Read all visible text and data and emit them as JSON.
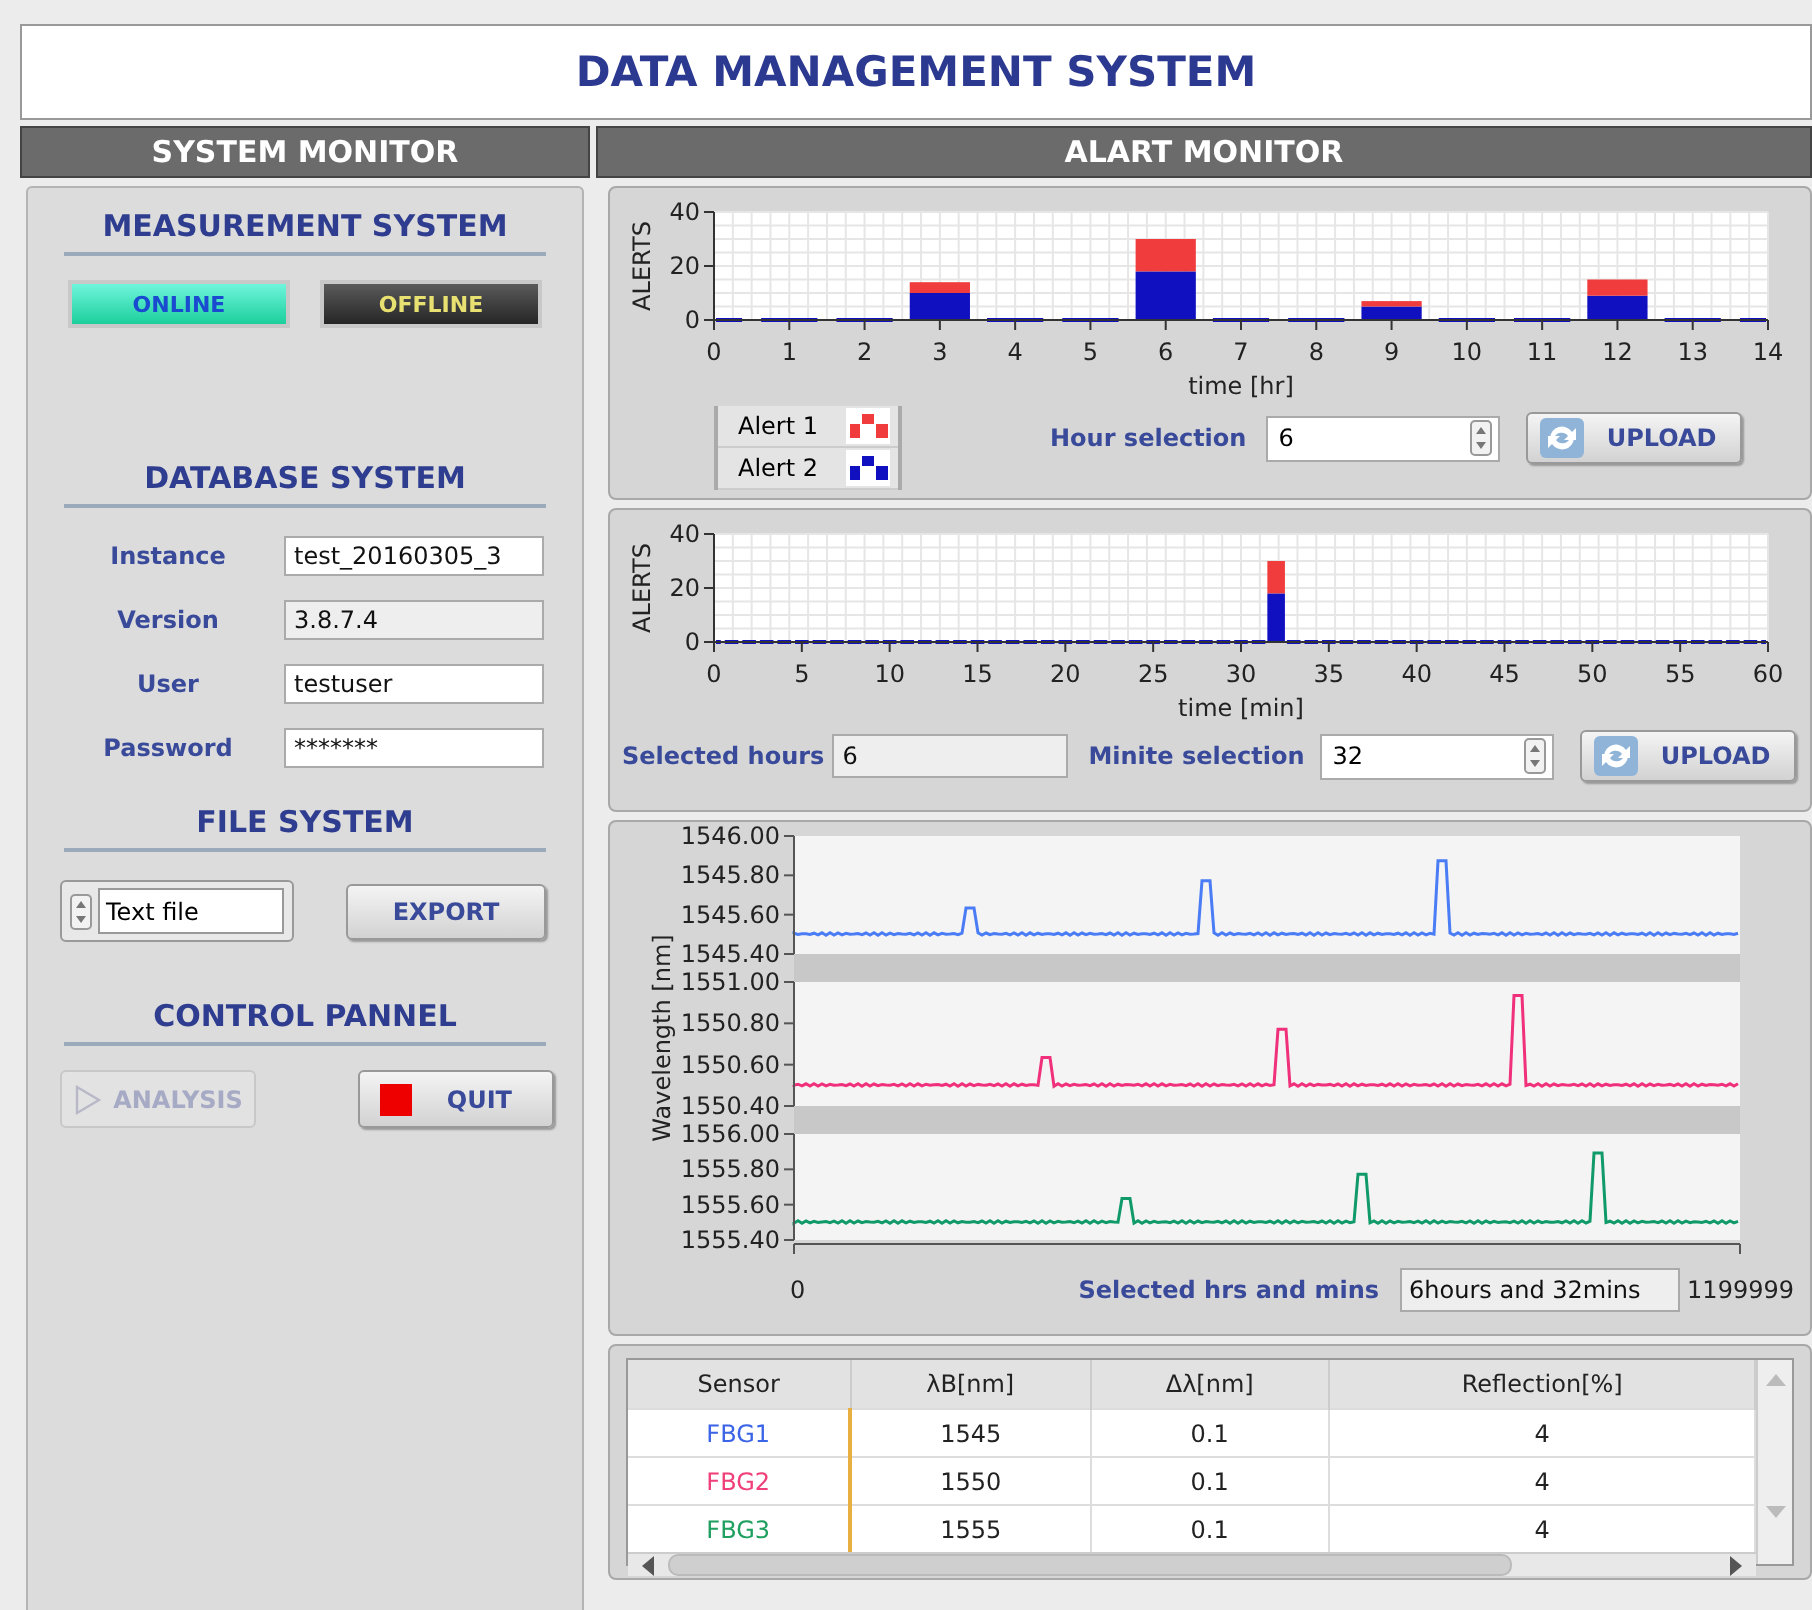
{
  "window": {
    "title": "DATA MANAGEMENT SYSTEM"
  },
  "system_monitor": {
    "title": "SYSTEM MONITOR",
    "measurement": {
      "heading": "MEASUREMENT SYSTEM",
      "buttons": [
        {
          "label": "ONLINE",
          "on": true
        },
        {
          "label": "OFFLINE",
          "on": false
        }
      ]
    },
    "database": {
      "heading": "DATABASE SYSTEM",
      "fields": [
        {
          "label": "Instance",
          "value": "test_20160305_3",
          "disabled": false
        },
        {
          "label": "Version",
          "value": "3.8.7.4",
          "disabled": true
        },
        {
          "label": "User",
          "value": "testuser",
          "disabled": false
        },
        {
          "label": "Password",
          "value": "*******",
          "disabled": false
        }
      ]
    },
    "file": {
      "heading": "FILE SYSTEM",
      "format": "Text file",
      "button": "EXPORT"
    },
    "control": {
      "heading": "CONTROL PANNEL",
      "analysis": {
        "label": "ANALYSIS",
        "disabled": true
      },
      "quit": {
        "label": "QUIT",
        "disabled": false
      }
    }
  },
  "alert_monitor": {
    "title": "ALART MONITOR",
    "hour_chart": {
      "chart_data": {
        "type": "bar",
        "xlabel": "time [hr]",
        "ylabel": "ALERTS",
        "stacked": true,
        "grid": true,
        "x": [
          0,
          1,
          2,
          3,
          4,
          5,
          6,
          7,
          8,
          9,
          10,
          11,
          12,
          13,
          14
        ],
        "xlim": [
          0,
          14
        ],
        "ylim": [
          0,
          40
        ],
        "xticks": [
          0,
          1,
          2,
          3,
          4,
          5,
          6,
          7,
          8,
          9,
          10,
          11,
          12,
          13,
          14
        ],
        "yticks": [
          0,
          20,
          40
        ],
        "series": [
          {
            "name": "Alert 1",
            "color": "#f03c3c",
            "values": [
              0,
              0,
              0,
              4,
              0,
              0,
              12,
              0,
              0,
              2,
              0,
              0,
              6,
              0,
              0
            ]
          },
          {
            "name": "Alert 2",
            "color": "#1010c0",
            "values": [
              0,
              0,
              0,
              10,
              0,
              0,
              18,
              0,
              0,
              5,
              0,
              0,
              9,
              0,
              0
            ]
          }
        ]
      },
      "selection_label": "Hour selection",
      "selection_value": "6",
      "button": "UPLOAD"
    },
    "minute_chart": {
      "chart_data": {
        "type": "bar",
        "xlabel": "time [min]",
        "ylabel": "ALERTS",
        "stacked": true,
        "grid": true,
        "x": [
          0,
          1,
          2,
          3,
          4,
          5,
          6,
          7,
          8,
          9,
          10,
          11,
          12,
          13,
          14,
          15,
          16,
          17,
          18,
          19,
          20,
          21,
          22,
          23,
          24,
          25,
          26,
          27,
          28,
          29,
          30,
          31,
          32,
          33,
          34,
          35,
          36,
          37,
          38,
          39,
          40,
          41,
          42,
          43,
          44,
          45,
          46,
          47,
          48,
          49,
          50,
          51,
          52,
          53,
          54,
          55,
          56,
          57,
          58,
          59,
          60
        ],
        "xlim": [
          0,
          60
        ],
        "ylim": [
          0,
          40
        ],
        "xticks": [
          0,
          5,
          10,
          15,
          20,
          25,
          30,
          35,
          40,
          45,
          50,
          55,
          60
        ],
        "yticks": [
          0,
          20,
          40
        ],
        "series": [
          {
            "color": "#f03c3c",
            "values": [
              0,
              0,
              0,
              0,
              0,
              0,
              0,
              0,
              0,
              0,
              0,
              0,
              0,
              0,
              0,
              0,
              0,
              0,
              0,
              0,
              0,
              0,
              0,
              0,
              0,
              0,
              0,
              0,
              0,
              0,
              0,
              0,
              12,
              0,
              0,
              0,
              0,
              0,
              0,
              0,
              0,
              0,
              0,
              0,
              0,
              0,
              0,
              0,
              0,
              0,
              0,
              0,
              0,
              0,
              0,
              0,
              0,
              0,
              0,
              0,
              0
            ]
          },
          {
            "color": "#1010c0",
            "values": [
              0,
              0,
              0,
              0,
              0,
              0,
              0,
              0,
              0,
              0,
              0,
              0,
              0,
              0,
              0,
              0,
              0,
              0,
              0,
              0,
              0,
              0,
              0,
              0,
              0,
              0,
              0,
              0,
              0,
              0,
              0,
              0,
              18,
              0,
              0,
              0,
              0,
              0,
              0,
              0,
              0,
              0,
              0,
              0,
              0,
              0,
              0,
              0,
              0,
              0,
              0,
              0,
              0,
              0,
              0,
              0,
              0,
              0,
              0,
              0,
              0
            ]
          }
        ]
      },
      "hours_label": "Selected hours",
      "hours_value": "6",
      "selection_label": "Minite selection",
      "selection_value": "32",
      "button": "UPLOAD"
    },
    "wavelength": {
      "ylabel": "Wavelength [nm]",
      "x_start": "0",
      "x_end": "1199999",
      "panes": [
        {
          "color": "#4a7cf5",
          "yticks": [
            "1546.00",
            "1545.80",
            "1545.60",
            "1545.40"
          ]
        },
        {
          "color": "#f0307a",
          "yticks": [
            "1551.00",
            "1550.80",
            "1550.60",
            "1550.40"
          ]
        },
        {
          "color": "#109a6a",
          "yticks": [
            "1556.00",
            "1555.80",
            "1555.60",
            "1555.40"
          ]
        }
      ],
      "selection_label": "Selected hrs and mins",
      "selection_value": "6hours and 32mins"
    },
    "table": {
      "columns": [
        "Sensor",
        "λB[nm]",
        "Δλ[nm]",
        "Reflection[%]"
      ],
      "rows": [
        {
          "color": "#3c64e6",
          "cells": [
            "FBG1",
            "1545",
            "0.1",
            "4"
          ]
        },
        {
          "color": "#f0407a",
          "cells": [
            "FBG2",
            "1550",
            "0.1",
            "4"
          ]
        },
        {
          "color": "#20a060",
          "cells": [
            "FBG3",
            "1555",
            "0.1",
            "4"
          ]
        }
      ]
    }
  }
}
